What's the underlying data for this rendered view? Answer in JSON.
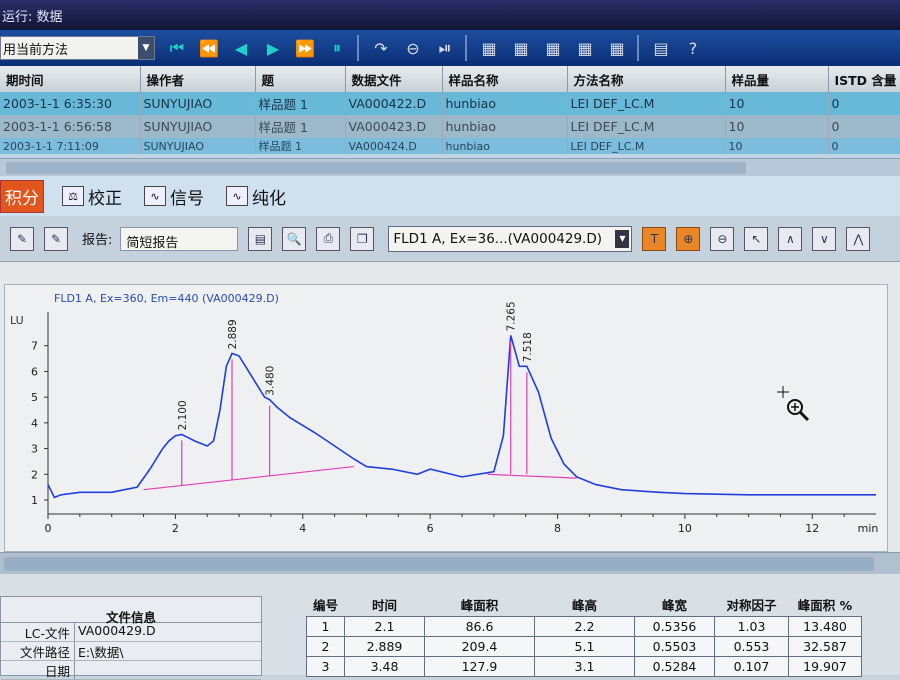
{
  "window": {
    "title": "运行: 数据"
  },
  "toolbar": {
    "method_label": "用当前方法",
    "icons": [
      "first-icon",
      "prev-icon",
      "back-icon",
      "forward-icon",
      "next-icon",
      "pause-icon",
      "redo-icon",
      "stop-icon",
      "pause-circle-icon",
      "layout-icon",
      "layout-icon",
      "layout-icon",
      "layout-icon",
      "layout-icon",
      "sidebar-icon",
      "help-icon"
    ]
  },
  "runs_table": {
    "headers": [
      "期时间",
      "操作者",
      "题",
      "数据文件",
      "样品名称",
      "方法名称",
      "样品量",
      "ISTD 含量"
    ],
    "rows": [
      [
        "2003-1-1 6:35:30",
        "SUNYUJIAO",
        "样品题 1",
        "VA000422.D",
        "hunbiao",
        "LEI DEF_LC.M",
        "10",
        "0"
      ],
      [
        "2003-1-1 6:56:58",
        "SUNYUJIAO",
        "样品题 1",
        "VA000423.D",
        "hunbiao",
        "LEI DEF_LC.M",
        "10",
        "0"
      ],
      [
        "2003-1-1 7:11:09",
        "SUNYUJIAO",
        "样品题 1",
        "VA000424.D",
        "hunbiao",
        "LEI DEF_LC.M",
        "10",
        "0"
      ]
    ]
  },
  "tabs": [
    {
      "label": "积分",
      "active": true
    },
    {
      "label": "校正",
      "active": false
    },
    {
      "label": "信号",
      "active": false
    },
    {
      "label": "纯化",
      "active": false
    }
  ],
  "report": {
    "label": "报告:",
    "value": "简短报告"
  },
  "signal": {
    "selected": "FLD1 A, Ex=36...(VA000429.D)"
  },
  "chart_data": {
    "type": "line",
    "title": "FLD1 A, Ex=360, Em=440 (VA000429.D)",
    "ylabel": "LU",
    "xlabel": "min",
    "xlim": [
      0,
      13
    ],
    "ylim": [
      1,
      8
    ],
    "x_ticks": [
      "0",
      "2",
      "4",
      "6",
      "8",
      "10",
      "12",
      "min"
    ],
    "y_ticks": [
      "1",
      "2",
      "3",
      "4",
      "5",
      "6",
      "7"
    ],
    "accent_line": "#1f3fdc",
    "baseline_color": "#e040b0",
    "x": [
      0,
      0.1,
      0.2,
      0.5,
      1.0,
      1.4,
      1.6,
      1.8,
      1.9,
      2.0,
      2.1,
      2.3,
      2.5,
      2.6,
      2.7,
      2.8,
      2.889,
      3.0,
      3.2,
      3.4,
      3.48,
      3.6,
      3.8,
      4.2,
      4.8,
      5.0,
      5.4,
      5.8,
      6.0,
      6.5,
      7.0,
      7.15,
      7.265,
      7.4,
      7.518,
      7.7,
      7.9,
      8.1,
      8.3,
      8.6,
      9.0,
      9.6,
      10,
      11,
      12,
      13
    ],
    "y": [
      1.6,
      1.1,
      1.2,
      1.3,
      1.3,
      1.5,
      2.2,
      3.0,
      3.3,
      3.5,
      3.55,
      3.3,
      3.1,
      3.3,
      4.5,
      6.2,
      6.7,
      6.6,
      5.8,
      5.0,
      4.9,
      4.6,
      4.2,
      3.6,
      2.6,
      2.3,
      2.2,
      2.0,
      2.2,
      1.9,
      2.1,
      3.5,
      7.4,
      6.2,
      6.2,
      5.2,
      3.4,
      2.4,
      1.9,
      1.6,
      1.4,
      1.3,
      1.25,
      1.2,
      1.2,
      1.2
    ],
    "peaks": [
      {
        "label": "2.100",
        "x": 2.1,
        "y": 3.55
      },
      {
        "label": "2.889",
        "x": 2.889,
        "y": 6.7
      },
      {
        "label": "3.480",
        "x": 3.48,
        "y": 4.9
      },
      {
        "label": "7.265",
        "x": 7.265,
        "y": 7.4
      },
      {
        "label": "7.518",
        "x": 7.518,
        "y": 6.2
      }
    ]
  },
  "file_info": {
    "title": "文件信息",
    "rows": [
      {
        "key": "LC-文件",
        "value": "VA000429.D"
      },
      {
        "key": "文件路径",
        "value": "E:\\数据\\"
      },
      {
        "key": "日期",
        "value": ""
      }
    ]
  },
  "peak_table": {
    "headers": [
      "编号",
      "时间",
      "峰面积",
      "峰高",
      "峰宽",
      "对称因子",
      "峰面积 %"
    ],
    "rows": [
      [
        "1",
        "2.1",
        "86.6",
        "2.2",
        "0.5356",
        "1.03",
        "13.480"
      ],
      [
        "2",
        "2.889",
        "209.4",
        "5.1",
        "0.5503",
        "0.553",
        "32.587"
      ],
      [
        "3",
        "3.48",
        "127.9",
        "3.1",
        "0.5284",
        "0.107",
        "19.907"
      ]
    ]
  }
}
